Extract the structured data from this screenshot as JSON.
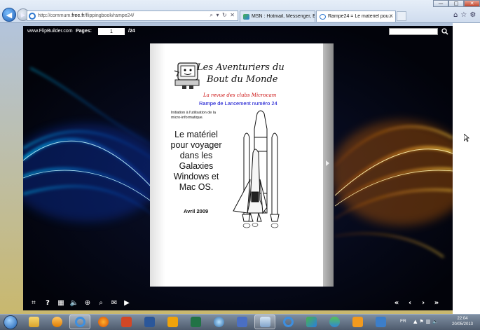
{
  "browser": {
    "url_host": "http://commum.",
    "url_domain": "free.fr",
    "url_path": "/flippingbook/rampe24/",
    "url_controls": "⌕ ▾ ↻ ✕",
    "tabs": [
      {
        "label": "MSN : Hotmail, Messenger, Bi...",
        "active": false
      },
      {
        "label": "Rampe24 = Le materiel pou...",
        "active": true
      }
    ],
    "tab_close": "✕"
  },
  "window": {
    "minimize": "—",
    "maximize": "□",
    "close": "✕"
  },
  "flipbook": {
    "brand": "www.FlipBuilder.com",
    "pages_label": "Pages:",
    "current_page": "1",
    "total_pages": "/24"
  },
  "page": {
    "title_line1": "Les Aventuriers du",
    "title_line2": "Bout du Monde",
    "subtitle": "La revue des clubs Microcam",
    "rampe": "Rampe de Lancement numéro  24",
    "initiation": "Initiation à l'utilisation de la micro-informatique.",
    "main_title": "Le matériel pour voyager dans les Galaxies Windows et Mac OS.",
    "date": "Avril 2009"
  },
  "taskbar": {
    "lang": "FR",
    "time": "22:04",
    "date": "20/05/2013"
  },
  "colors": {
    "subtitle": "#cc1111",
    "rampe": "#0000cc",
    "blue_swirl": "#1e7bff",
    "orange_swirl": "#ff9a1a"
  }
}
